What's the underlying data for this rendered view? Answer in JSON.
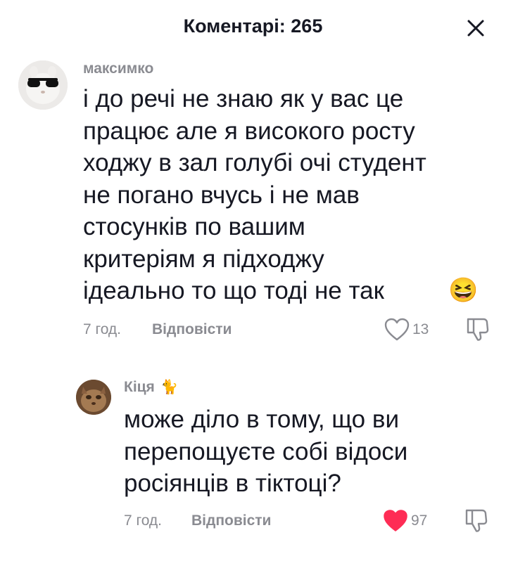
{
  "header": {
    "title": "Коментарі: 265",
    "close_icon": "close-icon"
  },
  "comments": [
    {
      "username": "максимко",
      "text": "і до речі не знаю як у вас це\nпрацює але я високого росту\nходжу в зал голубі очі студент\nне погано вчусь і не мав\nстосунків по вашим\nкритеріям я підходжу\nідеально то що тоді не так",
      "emoji": "😆",
      "time": "7 год.",
      "reply_label": "Відповісти",
      "likes": "13",
      "liked": false
    },
    {
      "username": "Кіця",
      "username_emoji": "🐈",
      "text": "може діло в тому, що ви\nперепощуєте собі відоси\nросіянців в тіктоці?",
      "time": "7 год.",
      "reply_label": "Відповісти",
      "likes": "97",
      "liked": true
    }
  ],
  "colors": {
    "like_active": "#fe2c55",
    "muted": "#8a8b91",
    "text": "#161823"
  }
}
